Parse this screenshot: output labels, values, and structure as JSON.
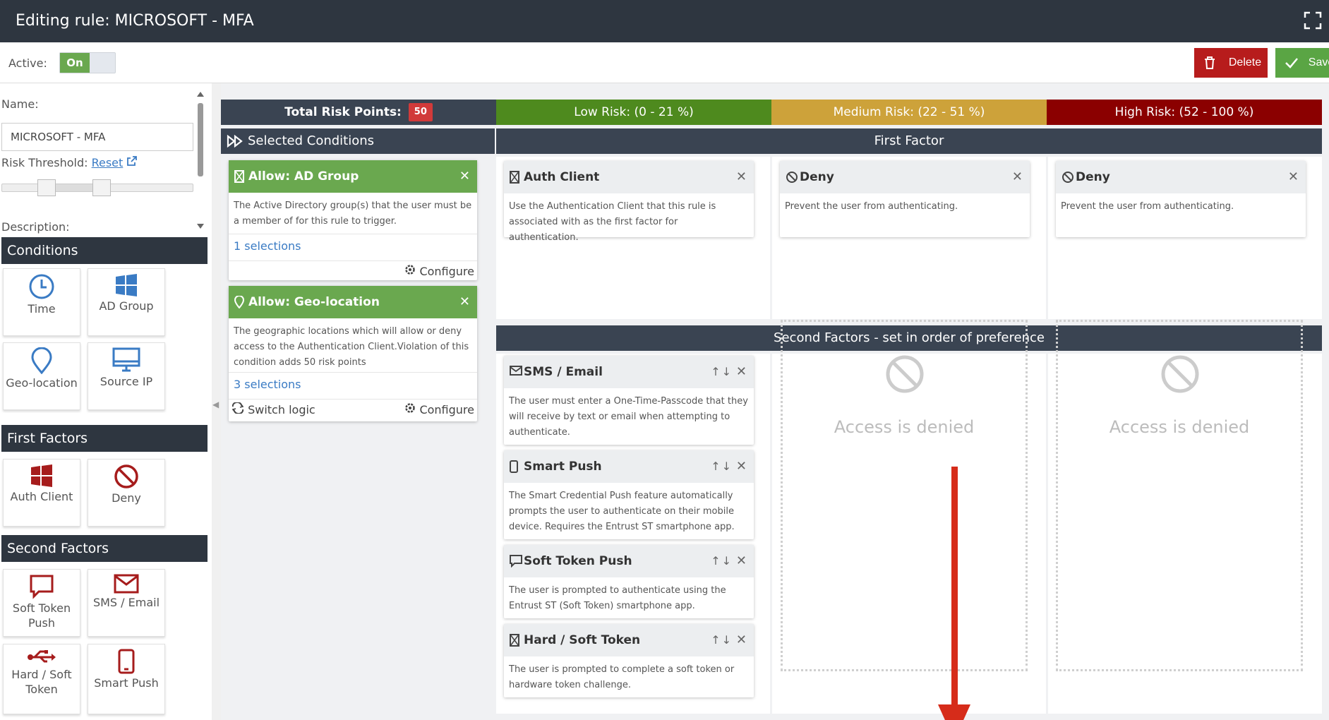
{
  "window": {
    "title": "Editing rule: MICROSOFT - MFA",
    "fullscreen_icon": "expand-icon"
  },
  "actions": {
    "active_label": "Active:",
    "active_value": "On",
    "delete_label": "Delete",
    "save_label": "Save"
  },
  "form": {
    "name_label": "Name:",
    "name_value": "MICROSOFT - MFA",
    "risk_label": "Risk Threshold:",
    "reset_label": "Reset",
    "description_label": "Description:"
  },
  "palette": {
    "conditions": {
      "title": "Conditions",
      "items": [
        {
          "label": "Time",
          "icon": "clock-icon"
        },
        {
          "label": "AD Group",
          "icon": "windows-icon"
        },
        {
          "label": "Geo-location",
          "icon": "map-pin-icon"
        },
        {
          "label": "Source IP",
          "icon": "monitor-icon"
        }
      ]
    },
    "first_factors": {
      "title": "First Factors",
      "items": [
        {
          "label": "Auth Client",
          "icon": "windows-icon"
        },
        {
          "label": "Deny",
          "icon": "ban-icon"
        }
      ]
    },
    "second_factors": {
      "title": "Second Factors",
      "items": [
        {
          "label": "Soft Token",
          "label2": "Push",
          "icon": "chat-icon"
        },
        {
          "label": "SMS / Email",
          "icon": "envelope-icon"
        },
        {
          "label": "Hard / Soft",
          "label2": "Token",
          "icon": "usb-icon"
        },
        {
          "label": "Smart Push",
          "icon": "phone-icon"
        }
      ]
    }
  },
  "risk": {
    "total_label": "Total Risk Points:",
    "total_value": "50",
    "low": "Low Risk: (0 - 21 %)",
    "medium": "Medium Risk: (22 - 51 %)",
    "high": "High Risk: (52 - 100 %)",
    "colors": {
      "low": "#4e8a1e",
      "medium": "#cda23a",
      "high": "#8b0000",
      "header": "#3a4452"
    }
  },
  "selected": {
    "title": "Selected Conditions",
    "cards": [
      {
        "title": "Allow: AD Group",
        "desc": "The Active Directory group(s) that the user must be a member of for this rule to trigger.",
        "selections": "1 selections",
        "configure": "Configure"
      },
      {
        "title": "Allow: Geo-location",
        "desc": "The geographic locations which will allow or deny access to the Authentication Client.Violation of this condition adds 50 risk points",
        "selections": "3 selections",
        "switch": "Switch logic",
        "configure": "Configure"
      }
    ]
  },
  "first_factor": {
    "title": "First Factor",
    "cards": [
      {
        "title": "Auth Client",
        "desc": "Use the Authentication Client that this rule is associated with as the first factor for authentication."
      },
      {
        "title": "Deny",
        "desc": "Prevent the user from authenticating."
      },
      {
        "title": "Deny",
        "desc": "Prevent the user from authenticating."
      }
    ]
  },
  "second_factors": {
    "title": "Second Factors - set in order of preference",
    "cards": [
      {
        "title": "SMS / Email",
        "desc": "The user must enter a One-Time-Passcode that they will receive by text or email when attempting to authenticate."
      },
      {
        "title": "Smart Push",
        "desc": "The Smart Credential Push feature automatically prompts the user to authenticate on their mobile device. Requires the Entrust ST smartphone app."
      },
      {
        "title": "Soft Token Push",
        "desc": "The user is prompted to authenticate using the Entrust ST (Soft Token) smartphone app."
      },
      {
        "title": "Hard / Soft Token",
        "desc": "The user is prompted to complete a soft token or hardware token challenge."
      }
    ],
    "denied_text": "Access is denied"
  }
}
